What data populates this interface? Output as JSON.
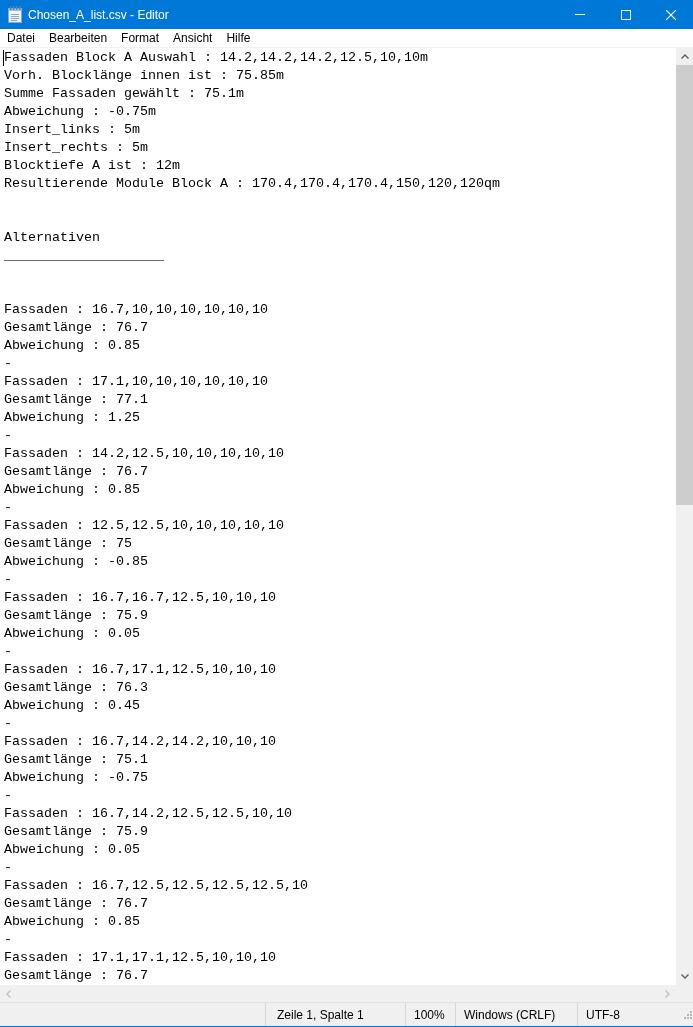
{
  "window": {
    "title": "Chosen_A_list.csv - Editor"
  },
  "menu": [
    "Datei",
    "Bearbeiten",
    "Format",
    "Ansicht",
    "Hilfe"
  ],
  "editor": {
    "paragraphs": [
      [
        "Fassaden Block A Auswahl : 14.2,14.2,14.2,12.5,10,10m",
        "Vorh. Blocklänge innen ist : 75.85m",
        "Summe Fassaden gewählt : 75.1m",
        "Abweichung : -0.75m",
        "Insert_links : 5m",
        "Insert_rechts : 5m",
        "Blocktiefe A ist : 12m",
        "Resultierende Module Block A : 170.4,170.4,170.4,150,120,120qm"
      ],
      [
        "Alternativen",
        "____________________"
      ],
      [
        "Fassaden : 16.7,10,10,10,10,10,10",
        "Gesamtlänge : 76.7",
        "Abweichung : 0.85",
        "-",
        "Fassaden : 17.1,10,10,10,10,10,10",
        "Gesamtlänge : 77.1",
        "Abweichung : 1.25",
        "-",
        "Fassaden : 14.2,12.5,10,10,10,10,10",
        "Gesamtlänge : 76.7",
        "Abweichung : 0.85",
        "-",
        "Fassaden : 12.5,12.5,10,10,10,10,10",
        "Gesamtlänge : 75",
        "Abweichung : -0.85",
        "-",
        "Fassaden : 16.7,16.7,12.5,10,10,10",
        "Gesamtlänge : 75.9",
        "Abweichung : 0.05",
        "-",
        "Fassaden : 16.7,17.1,12.5,10,10,10",
        "Gesamtlänge : 76.3",
        "Abweichung : 0.45",
        "-",
        "Fassaden : 16.7,14.2,14.2,10,10,10",
        "Gesamtlänge : 75.1",
        "Abweichung : -0.75",
        "-",
        "Fassaden : 16.7,14.2,12.5,12.5,10,10",
        "Gesamtlänge : 75.9",
        "Abweichung : 0.05",
        "-",
        "Fassaden : 16.7,12.5,12.5,12.5,12.5,10",
        "Gesamtlänge : 76.7",
        "Abweichung : 0.85",
        "-",
        "Fassaden : 17.1,17.1,12.5,10,10,10",
        "Gesamtlänge : 76.7"
      ]
    ]
  },
  "status_bar": {
    "position": "Zeile 1, Spalte 1",
    "zoom": "100%",
    "line_ending": "Windows (CRLF)",
    "encoding": "UTF-8"
  }
}
